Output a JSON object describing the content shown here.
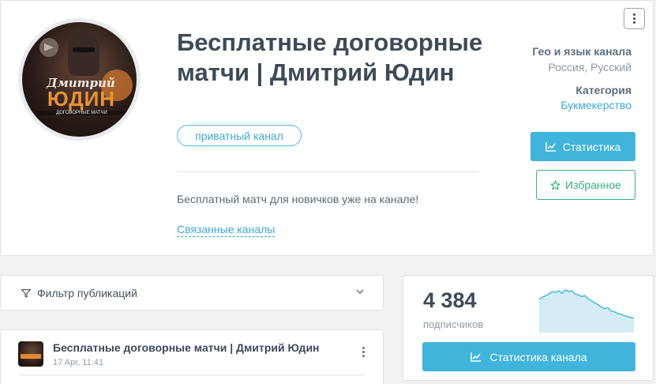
{
  "channel": {
    "title": "Бесплатные договорные матчи | Дмитрий Юдин",
    "avatar_lines": [
      "Дмитрий",
      "ЮДИН",
      "ДОГОВОРНЫЕ МАТЧИ"
    ],
    "badge": "приватный канал",
    "description": "Бесплатный матч для новичков уже на канале!",
    "related_link": "Связанные каналы"
  },
  "meta": {
    "geo_label": "Гео и язык канала",
    "geo_value": "Россия, Русский",
    "category_label": "Категория",
    "category_value": "Букмекерство"
  },
  "actions": {
    "stats_button": "Статистика",
    "favorite_button": "Избранное"
  },
  "filter": {
    "label": "Фильтр публикаций"
  },
  "post": {
    "title": "Бесплатные договорные матчи | Дмитрий Юдин",
    "time": "17 Apr, 11:41"
  },
  "subscribers": {
    "count": "4 384",
    "label": "подписчиков",
    "channel_stats_button": "Статистика канала"
  },
  "colors": {
    "accent": "#41b4dc",
    "favorite": "#36b37e",
    "text": "#3d4b58"
  },
  "chart_data": {
    "type": "area",
    "series": [
      {
        "values": [
          40,
          42,
          44,
          46,
          49,
          48,
          50,
          47,
          51,
          49,
          50,
          46,
          45,
          43,
          44,
          40,
          38,
          35,
          33,
          30,
          28,
          29,
          25,
          24,
          22,
          21,
          19,
          18,
          17,
          16
        ]
      }
    ]
  }
}
